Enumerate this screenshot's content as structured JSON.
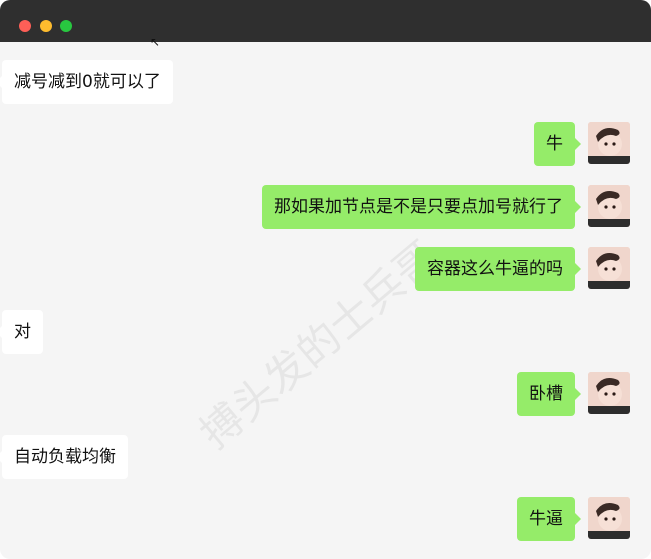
{
  "window": {
    "watermark_text": "搏头发的士兵哥"
  },
  "messages": [
    {
      "side": "incoming",
      "text": "减号减到0就可以了"
    },
    {
      "side": "outgoing",
      "text": "牛"
    },
    {
      "side": "outgoing",
      "text": "那如果加节点是不是只要点加号就行了"
    },
    {
      "side": "outgoing",
      "text": "容器这么牛逼的吗"
    },
    {
      "side": "incoming",
      "text": "对"
    },
    {
      "side": "outgoing",
      "text": "卧槽"
    },
    {
      "side": "incoming",
      "text": "自动负载均衡"
    },
    {
      "side": "outgoing",
      "text": "牛逼"
    }
  ],
  "colors": {
    "incoming_bubble": "#ffffff",
    "outgoing_bubble": "#95ec69",
    "background": "#f5f5f5",
    "titlebar": "#2f2f2f"
  }
}
